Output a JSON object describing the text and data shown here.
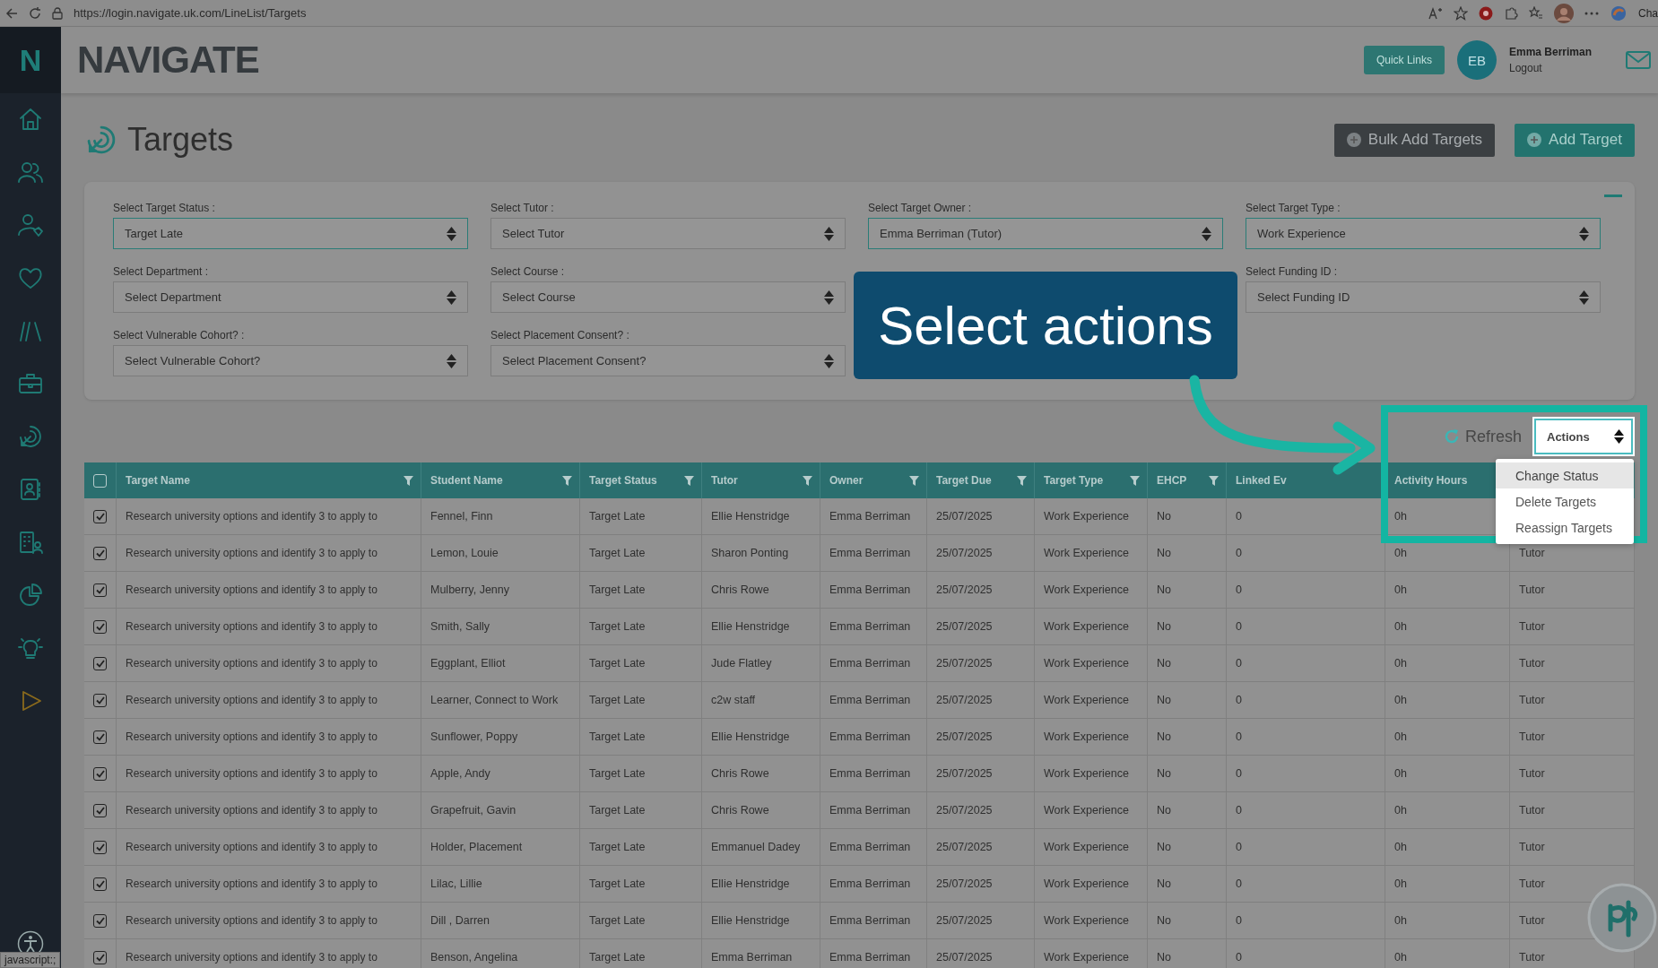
{
  "browser": {
    "url": "https://login.navigate.uk.com/LineList/Targets",
    "profile_label": "Cha",
    "status_text": "javascript:;"
  },
  "sidebar": {
    "logo": "N"
  },
  "header": {
    "logo": "NAVIGATE",
    "quick_links": "Quick Links",
    "user": {
      "initials": "EB",
      "name": "Emma Berriman",
      "logout": "Logout"
    }
  },
  "page": {
    "title": "Targets",
    "buttons": [
      {
        "label": "Bulk Add Targets",
        "kind": "secondary"
      },
      {
        "label": "Add Target",
        "kind": "primary"
      }
    ]
  },
  "filter_rows": [
    [
      {
        "kind": "select",
        "label": "Select Target Status :",
        "value": "Target Late",
        "filled": true
      },
      {
        "kind": "select",
        "label": "Select Tutor :",
        "value": "Select Tutor",
        "filled": false
      },
      {
        "kind": "select",
        "label": "Select Target Owner :",
        "value": "Emma Berriman (Tutor)",
        "filled": true
      },
      {
        "kind": "select",
        "label": "Select Target Type :",
        "value": "Work Experience",
        "filled": true
      }
    ],
    [
      {
        "kind": "select",
        "label": "Select Department :",
        "value": "Select Department",
        "filled": false
      },
      {
        "kind": "select",
        "label": "Select Course :",
        "value": "Select Course",
        "filled": false
      },
      {
        "kind": "covered"
      },
      {
        "kind": "select",
        "label": "Select Funding ID :",
        "value": "Select Funding ID",
        "filled": false
      }
    ],
    [
      {
        "kind": "select",
        "label": "Select Vulnerable Cohort? :",
        "value": "Select Vulnerable Cohort?",
        "filled": false
      },
      {
        "kind": "select",
        "label": "Select Placement Consent? :",
        "value": "Select Placement Consent?",
        "filled": false
      }
    ]
  ],
  "toolbar": {
    "refresh": "Refresh",
    "actions": {
      "label": "Actions",
      "expanded": true,
      "options": [
        {
          "label": "Change Status",
          "selected": true
        },
        {
          "label": "Delete Targets",
          "selected": false
        },
        {
          "label": "Reassign Targets",
          "selected": false
        }
      ]
    }
  },
  "callout": {
    "text": "Select actions"
  },
  "table": {
    "select_all": {
      "checked": false
    },
    "columns": [
      "Target Name",
      "Student Name",
      "Target Status",
      "Tutor",
      "Owner",
      "Target Due",
      "Target Type",
      "EHCP",
      "Linked Ev",
      "Activity Hours"
    ],
    "rows": [
      {
        "checked": true,
        "cells": [
          "Research university options and identify 3 to apply to",
          "Fennel, Finn",
          "Target Late",
          "Ellie Henstridge",
          "Emma Berriman",
          "25/07/2025",
          "Work Experience",
          "No",
          "0",
          "0h"
        ]
      },
      {
        "checked": true,
        "cells": [
          "Research university options and identify 3 to apply to",
          "Lemon, Louie",
          "Target Late",
          "Sharon Ponting",
          "Emma Berriman",
          "25/07/2025",
          "Work Experience",
          "No",
          "0",
          "0h",
          "Tutor"
        ]
      },
      {
        "checked": true,
        "cells": [
          "Research university options and identify 3 to apply to",
          "Mulberry, Jenny",
          "Target Late",
          "Chris Rowe",
          "Emma Berriman",
          "25/07/2025",
          "Work Experience",
          "No",
          "0",
          "0h",
          "Tutor"
        ]
      },
      {
        "checked": true,
        "cells": [
          "Research university options and identify 3 to apply to",
          "Smith, Sally",
          "Target Late",
          "Ellie Henstridge",
          "Emma Berriman",
          "25/07/2025",
          "Work Experience",
          "No",
          "0",
          "0h",
          "Tutor"
        ]
      },
      {
        "checked": true,
        "cells": [
          "Research university options and identify 3 to apply to",
          "Eggplant, Elliot",
          "Target Late",
          "Jude Flatley",
          "Emma Berriman",
          "25/07/2025",
          "Work Experience",
          "No",
          "0",
          "0h",
          "Tutor"
        ]
      },
      {
        "checked": true,
        "cells": [
          "Research university options and identify 3 to apply to",
          "Learner, Connect to Work",
          "Target Late",
          "c2w staff",
          "Emma Berriman",
          "25/07/2025",
          "Work Experience",
          "No",
          "0",
          "0h",
          "Tutor"
        ]
      },
      {
        "checked": true,
        "cells": [
          "Research university options and identify 3 to apply to",
          "Sunflower, Poppy",
          "Target Late",
          "Ellie Henstridge",
          "Emma Berriman",
          "25/07/2025",
          "Work Experience",
          "No",
          "0",
          "0h",
          "Tutor"
        ]
      },
      {
        "checked": true,
        "cells": [
          "Research university options and identify 3 to apply to",
          "Apple, Andy",
          "Target Late",
          "Chris Rowe",
          "Emma Berriman",
          "25/07/2025",
          "Work Experience",
          "No",
          "0",
          "0h",
          "Tutor"
        ]
      },
      {
        "checked": true,
        "cells": [
          "Research university options and identify 3 to apply to",
          "Grapefruit, Gavin",
          "Target Late",
          "Chris Rowe",
          "Emma Berriman",
          "25/07/2025",
          "Work Experience",
          "No",
          "0",
          "0h",
          "Tutor"
        ]
      },
      {
        "checked": true,
        "cells": [
          "Research university options and identify 3 to apply to",
          "Holder, Placement",
          "Target Late",
          "Emmanuel Dadey",
          "Emma Berriman",
          "25/07/2025",
          "Work Experience",
          "No",
          "0",
          "0h",
          "Tutor"
        ]
      },
      {
        "checked": true,
        "cells": [
          "Research university options and identify 3 to apply to",
          "Lilac, Lillie",
          "Target Late",
          "Ellie Henstridge",
          "Emma Berriman",
          "25/07/2025",
          "Work Experience",
          "No",
          "0",
          "0h",
          "Tutor"
        ]
      },
      {
        "checked": true,
        "cells": [
          "Research university options and identify 3 to apply to",
          "Dill , Darren",
          "Target Late",
          "Ellie Henstridge",
          "Emma Berriman",
          "25/07/2025",
          "Work Experience",
          "No",
          "0",
          "0h",
          "Tutor"
        ]
      },
      {
        "checked": true,
        "cells": [
          "Research university options and identify 3 to apply to",
          "Benson, Angelina",
          "Target Late",
          "Emma Berriman",
          "Emma Berriman",
          "25/07/2025",
          "Work Experience",
          "No",
          "0",
          "0h",
          "Tutor"
        ]
      }
    ]
  }
}
